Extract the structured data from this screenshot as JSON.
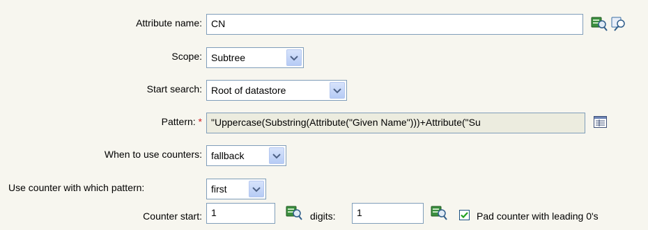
{
  "form": {
    "attribute_name": {
      "label": "Attribute name:",
      "value": "CN"
    },
    "scope": {
      "label": "Scope:",
      "selected": "Subtree"
    },
    "start_search": {
      "label": "Start search:",
      "selected": "Root of datastore"
    },
    "pattern": {
      "label": "Pattern:",
      "required_marker": "*",
      "value": "\"Uppercase(Substring(Attribute(\"Given Name\")))+Attribute(\"Su"
    },
    "when_counters": {
      "label": "When to use counters:",
      "selected": "fallback"
    },
    "counter_pattern": {
      "label": "Use counter with which pattern:",
      "selected": "first"
    },
    "counter_start": {
      "label": "Counter start:",
      "value": "1"
    },
    "digits": {
      "label": "digits:",
      "value": "1"
    },
    "pad": {
      "label": "Pad counter with leading 0's",
      "checked": true
    }
  },
  "icons": [
    "browse-icon",
    "lookup-icon",
    "editor-icon",
    "chevron-down-icon",
    "checkmark-icon"
  ],
  "colors": {
    "background": "#f7f6ef",
    "input_border": "#7f9db9",
    "required": "#d01c1c",
    "readonly_bg": "#ececdf"
  }
}
